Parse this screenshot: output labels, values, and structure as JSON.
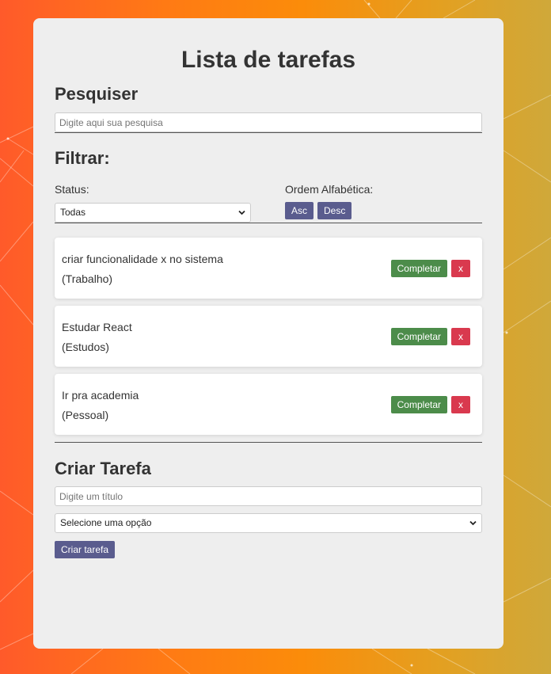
{
  "app": {
    "title": "Lista de tarefas"
  },
  "search": {
    "heading": "Pesquiser",
    "placeholder": "Digite aqui sua pesquisa"
  },
  "filter": {
    "heading": "Filtrar:",
    "status_label": "Status:",
    "status_selected": "Todas",
    "order_label": "Ordem Alfabética:",
    "asc_label": "Asc",
    "desc_label": "Desc"
  },
  "todos": [
    {
      "text": "criar funcionalidade x no sistema",
      "category": "(Trabalho)",
      "complete_label": "Completar",
      "remove_label": "x"
    },
    {
      "text": "Estudar React",
      "category": "(Estudos)",
      "complete_label": "Completar",
      "remove_label": "x"
    },
    {
      "text": "Ir pra academia",
      "category": "(Pessoal)",
      "complete_label": "Completar",
      "remove_label": "x"
    }
  ],
  "create": {
    "heading": "Criar Tarefa",
    "title_placeholder": "Digite um título",
    "category_selected": "Selecione uma opção",
    "submit_label": "Criar tarefa"
  },
  "colors": {
    "accent": "#5a5c8e",
    "complete": "#4c8c4a",
    "remove": "#d9394e",
    "card": "#eeeeee"
  }
}
